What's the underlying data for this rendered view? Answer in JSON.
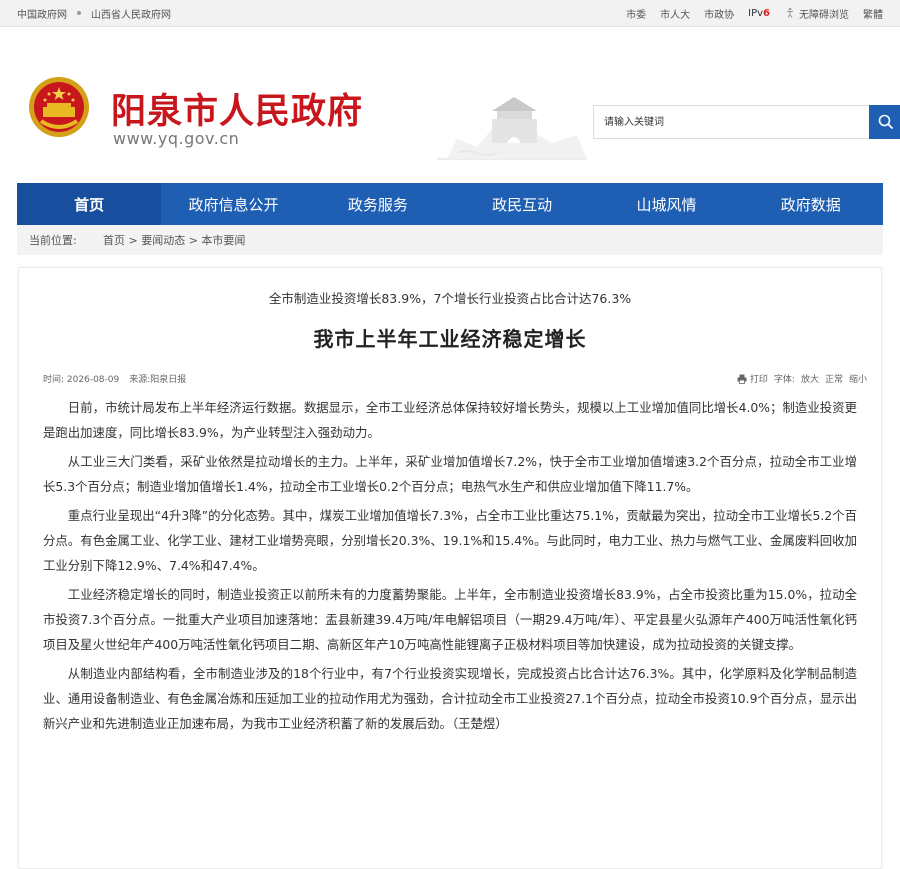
{
  "topbar": {
    "left_links": [
      "中国政府网",
      "山西省人民政府网"
    ],
    "right_links": [
      "市委",
      "市人大",
      "市政协"
    ],
    "ipv6_prefix": "IPv",
    "ipv6_num": "6",
    "accessibility": "无障碍浏览",
    "traditional": "繁體"
  },
  "header": {
    "title": "阳泉市人民政府",
    "url": "www.yq.gov.cn",
    "search_placeholder": "请输入关键词"
  },
  "nav": [
    "首页",
    "政府信息公开",
    "政务服务",
    "政民互动",
    "山城风情",
    "政府数据"
  ],
  "breadcrumb": {
    "label": "当前位置:",
    "path": "首页 > 要闻动态 > 本市要闻"
  },
  "article": {
    "subtitle": "全市制造业投资增长83.9%，7个增长行业投资占比合计达76.3%",
    "title": "我市上半年工业经济稳定增长",
    "time_label": "时间:",
    "time": "2026-08-09",
    "source_label": "来源:",
    "source": "阳泉日报",
    "print": "打印",
    "font_label": "字体:",
    "font_large": "放大",
    "font_normal": "正常",
    "font_small": "缩小",
    "paragraphs": [
      "日前，市统计局发布上半年经济运行数据。数据显示，全市工业经济总体保持较好增长势头，规模以上工业增加值同比增长4.0%；制造业投资更是跑出加速度，同比增长83.9%，为产业转型注入强劲动力。",
      "从工业三大门类看，采矿业依然是拉动增长的主力。上半年，采矿业增加值增长7.2%，快于全市工业增加值增速3.2个百分点，拉动全市工业增长5.3个百分点；制造业增加值增长1.4%，拉动全市工业增长0.2个百分点；电热气水生产和供应业增加值下降11.7%。",
      "重点行业呈现出“4升3降”的分化态势。其中，煤炭工业增加值增长7.3%，占全市工业比重达75.1%，贡献最为突出，拉动全市工业增长5.2个百分点。有色金属工业、化学工业、建材工业增势亮眼，分别增长20.3%、19.1%和15.4%。与此同时，电力工业、热力与燃气工业、金属废料回收加工业分别下降12.9%、7.4%和47.4%。",
      "工业经济稳定增长的同时，制造业投资正以前所未有的力度蓄势聚能。上半年，全市制造业投资增长83.9%，占全市投资比重为15.0%，拉动全市投资7.3个百分点。一批重大产业项目加速落地：盂县新建39.4万吨/年电解铝项目（一期29.4万吨/年）、平定县星火弘源年产400万吨活性氧化钙项目及星火世纪年产400万吨活性氧化钙项目二期、高新区年产10万吨高性能锂离子正极材料项目等加快建设，成为拉动投资的关键支撑。",
      "从制造业内部结构看，全市制造业涉及的18个行业中，有7个行业投资实现增长，完成投资占比合计达76.3%。其中，化学原料及化学制品制造业、通用设备制造业、有色金属冶炼和压延加工业的拉动作用尤为强劲，合计拉动全市工业投资27.1个百分点，拉动全市投资10.9个百分点，显示出新兴产业和先进制造业正加速布局，为我市工业经济积蓄了新的发展后劲。（王楚煜）"
    ]
  },
  "colors": {
    "nav_blue": "#1f5fb3",
    "title_red": "#c8161d"
  }
}
